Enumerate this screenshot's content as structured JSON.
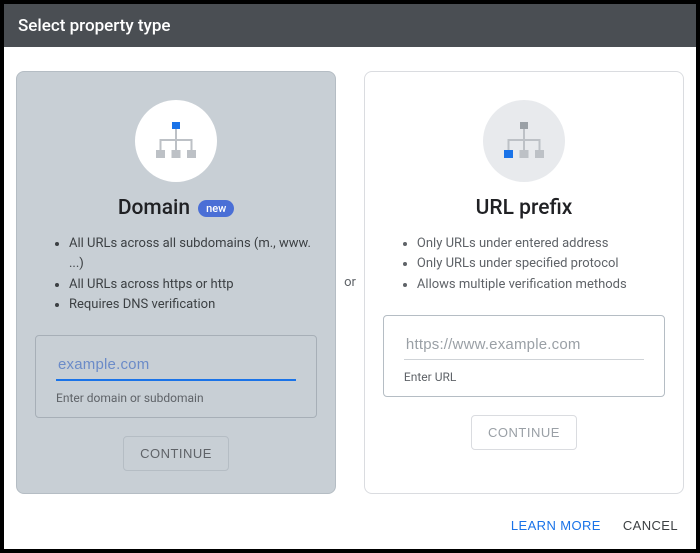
{
  "header": {
    "title": "Select property type"
  },
  "or_label": "or",
  "domain_card": {
    "title": "Domain",
    "badge": "new",
    "bullets": [
      "All URLs across all subdomains (m., www. ...)",
      "All URLs across https or http",
      "Requires DNS verification"
    ],
    "placeholder": "example.com",
    "hint": "Enter domain or subdomain",
    "continue": "CONTINUE"
  },
  "url_card": {
    "title": "URL prefix",
    "bullets": [
      "Only URLs under entered address",
      "Only URLs under specified protocol",
      "Allows multiple verification methods"
    ],
    "placeholder": "https://www.example.com",
    "hint": "Enter URL",
    "continue": "CONTINUE"
  },
  "footer": {
    "learn_more": "LEARN MORE",
    "cancel": "CANCEL"
  }
}
